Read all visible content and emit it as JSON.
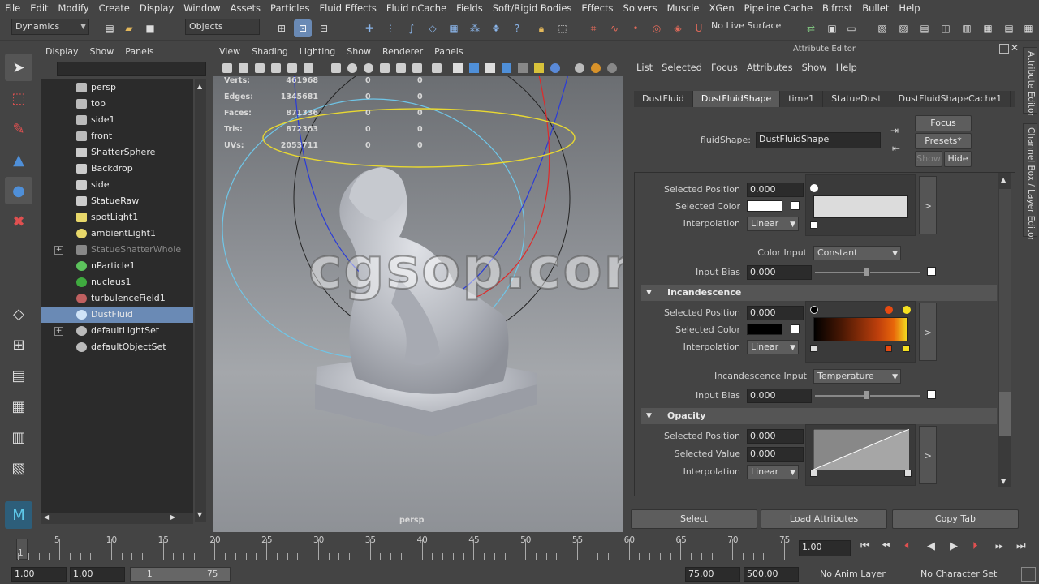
{
  "menubar": [
    "File",
    "Edit",
    "Modify",
    "Create",
    "Display",
    "Window",
    "Assets",
    "Particles",
    "Fluid Effects",
    "Fluid nCache",
    "Fields",
    "Soft/Rigid Bodies",
    "Effects",
    "Solvers",
    "Muscle",
    "XGen",
    "Pipeline Cache",
    "Bifrost",
    "Bullet",
    "Help"
  ],
  "status": {
    "menuset": "Dynamics",
    "selection_mode": "Objects",
    "live_surface": "No Live Surface"
  },
  "outliner": {
    "menu": [
      "Display",
      "Show",
      "Panels"
    ],
    "items": [
      {
        "label": "persp",
        "icon": "camera-icon"
      },
      {
        "label": "top",
        "icon": "camera-icon"
      },
      {
        "label": "side1",
        "icon": "camera-icon"
      },
      {
        "label": "front",
        "icon": "camera-icon"
      },
      {
        "label": "ShatterSphere",
        "icon": "mesh-icon"
      },
      {
        "label": "Backdrop",
        "icon": "mesh-icon"
      },
      {
        "label": "side",
        "icon": "mesh-icon"
      },
      {
        "label": "StatueRaw",
        "icon": "mesh-icon"
      },
      {
        "label": "spotLight1",
        "icon": "spotlight-icon"
      },
      {
        "label": "ambientLight1",
        "icon": "ambient-light-icon"
      },
      {
        "label": "StatueShatterWhole",
        "icon": "mesh-icon"
      },
      {
        "label": "nParticle1",
        "icon": "nparticle-icon"
      },
      {
        "label": "nucleus1",
        "icon": "nucleus-icon"
      },
      {
        "label": "turbulenceField1",
        "icon": "turbulence-icon"
      },
      {
        "label": "DustFluid",
        "icon": "fluid-icon"
      },
      {
        "label": "defaultLightSet",
        "icon": "set-icon"
      },
      {
        "label": "defaultObjectSet",
        "icon": "set-icon"
      }
    ]
  },
  "viewport": {
    "menu": [
      "View",
      "Shading",
      "Lighting",
      "Show",
      "Renderer",
      "Panels"
    ],
    "hud": [
      {
        "label": "Verts:",
        "a": "461968",
        "b": "0",
        "c": "0"
      },
      {
        "label": "Edges:",
        "a": "1345681",
        "b": "0",
        "c": "0"
      },
      {
        "label": "Faces:",
        "a": "871336",
        "b": "0",
        "c": "0"
      },
      {
        "label": "Tris:",
        "a": "872363",
        "b": "0",
        "c": "0"
      },
      {
        "label": "UVs:",
        "a": "2053711",
        "b": "0",
        "c": "0"
      }
    ],
    "camera_label": "persp",
    "watermark": "cgsop.com"
  },
  "attr": {
    "title": "Attribute Editor",
    "menu": [
      "List",
      "Selected",
      "Focus",
      "Attributes",
      "Show",
      "Help"
    ],
    "tabs": [
      "DustFluid",
      "DustFluidShape",
      "time1",
      "StatueDust",
      "DustFluidShapeCache1"
    ],
    "active_tab": 1,
    "node_label": "fluidShape:",
    "node_value": "DustFluidShape",
    "focus_btn": "Focus",
    "presets_btn": "Presets*",
    "show_btn": "Show",
    "hide_btn": "Hide",
    "color": {
      "sel_pos_label": "Selected Position",
      "sel_pos": "0.000",
      "sel_color_label": "Selected Color",
      "interp_label": "Interpolation",
      "interp": "Linear",
      "input_label": "Color Input",
      "input": "Constant",
      "bias_label": "Input Bias",
      "bias": "0.000"
    },
    "incandescence": {
      "header": "Incandescence",
      "sel_pos_label": "Selected Position",
      "sel_pos": "0.000",
      "sel_color_label": "Selected Color",
      "interp_label": "Interpolation",
      "interp": "Linear",
      "input_label": "Incandescence Input",
      "input": "Temperature",
      "bias_label": "Input Bias",
      "bias": "0.000"
    },
    "opacity": {
      "header": "Opacity",
      "sel_pos_label": "Selected Position",
      "sel_pos": "0.000",
      "sel_val_label": "Selected Value",
      "sel_val": "0.000",
      "interp_label": "Interpolation",
      "interp": "Linear"
    },
    "bottom": [
      "Select",
      "Load Attributes",
      "Copy Tab"
    ],
    "expand_glyph": ">"
  },
  "sidetabs": [
    "Attribute Editor",
    "Channel Box / Layer Editor"
  ],
  "timeline": {
    "ticks": [
      "5",
      "10",
      "15",
      "20",
      "25",
      "30",
      "35",
      "40",
      "45",
      "50",
      "55",
      "60",
      "65",
      "70",
      "75"
    ],
    "start_marker": "1",
    "current_frame": "1.00"
  },
  "range": {
    "start": "1.00",
    "play_start": "1.00",
    "slider_start": "1",
    "slider_end": "75",
    "play_end": "75.00",
    "end": "500.00",
    "anim_layer": "No Anim Layer",
    "char_set": "No Character Set"
  }
}
